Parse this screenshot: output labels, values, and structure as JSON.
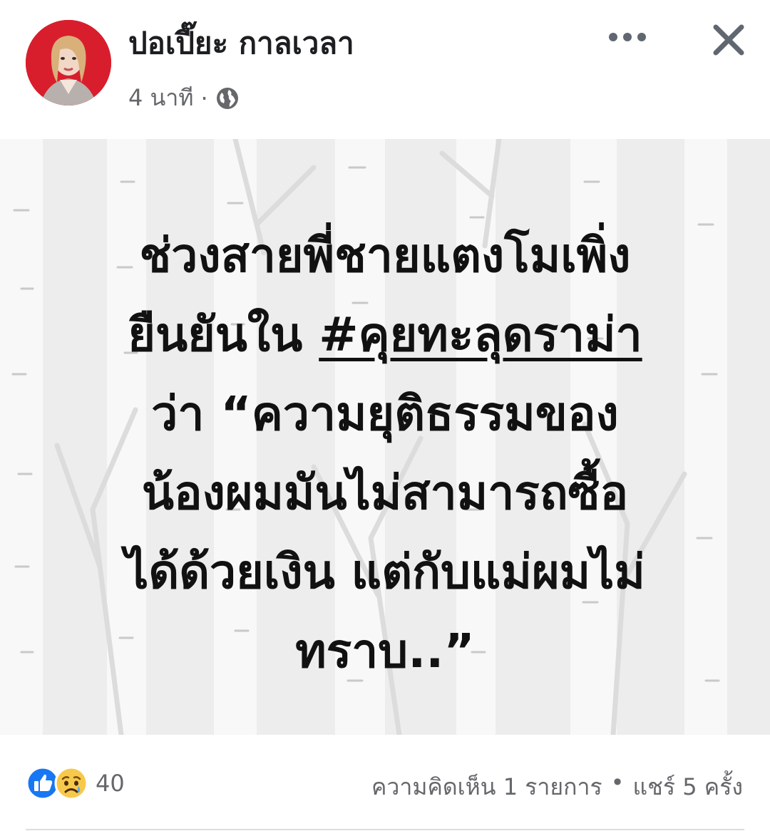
{
  "post": {
    "author_name": "ปอเปี๊ยะ กาลเวลา",
    "time_ago": "4 นาที",
    "separator": "·",
    "privacy_icon": "globe-icon"
  },
  "actions": {
    "more_icon": "more-horizontal-icon",
    "close_icon": "close-icon"
  },
  "image_text": {
    "line1": "ช่วงสายพี่ชายแตงโมเพิ่ง",
    "line2_prefix": "ยืนยันใน ",
    "line2_hashtag": "#คุยทะลุดราม่า",
    "line3": "ว่า “ความยุติธรรมของ",
    "line4": "น้องผมมันไม่สามารถซื้อ",
    "line5": "ได้ด้วยเงิน แต่กับแม่ผมไม่",
    "line6": "ทราบ..”"
  },
  "footer": {
    "reaction_icons": [
      "like-icon",
      "sad-icon"
    ],
    "reaction_count": "40",
    "comments": "ความคิดเห็น 1 รายการ",
    "bullet": "•",
    "shares": "แชร์ 5 ครั้ง"
  },
  "colors": {
    "text_primary": "#1c1e21",
    "text_secondary": "#65676b",
    "like_blue": "#1877f2",
    "image_bg": "#efefef"
  }
}
